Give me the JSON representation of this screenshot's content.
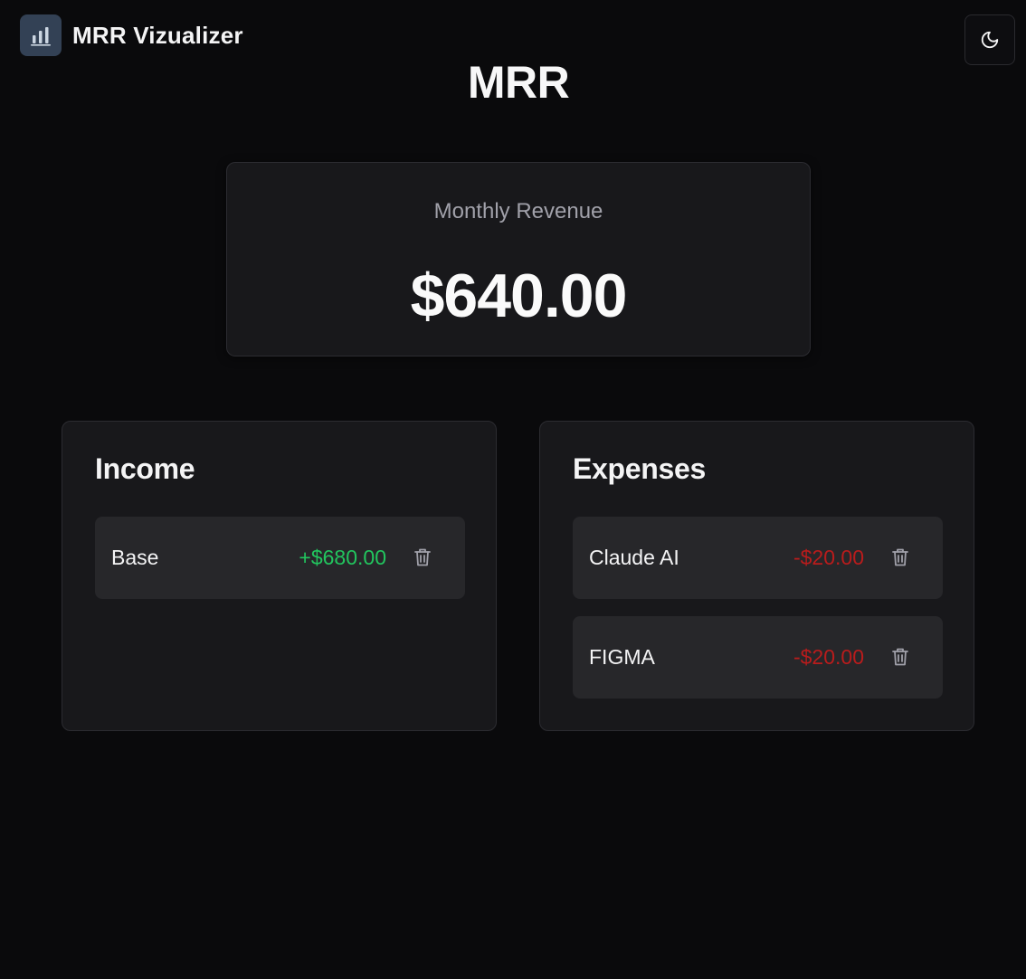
{
  "app": {
    "name": "MRR Vizualizer",
    "logo_icon": "bar-chart-icon",
    "theme_toggle_icon": "moon-icon"
  },
  "page": {
    "title": "MRR"
  },
  "summary": {
    "label": "Monthly Revenue",
    "value": "$640.00"
  },
  "income": {
    "title": "Income",
    "items": [
      {
        "name": "Base",
        "amount": "+$680.00"
      }
    ]
  },
  "expenses": {
    "title": "Expenses",
    "items": [
      {
        "name": "Claude AI",
        "amount": "-$20.00"
      },
      {
        "name": "FIGMA",
        "amount": "-$20.00"
      }
    ]
  },
  "colors": {
    "background": "#0a0a0c",
    "card": "#18181b",
    "row": "#27272a",
    "income_amount": "#22c55e",
    "expense_amount": "#b91c1c",
    "logo_bg": "#334155"
  }
}
